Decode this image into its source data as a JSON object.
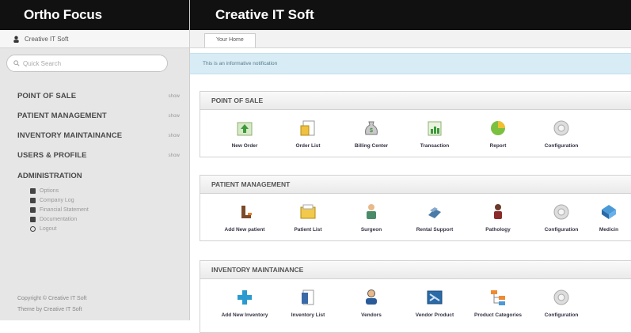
{
  "sidebar": {
    "brand": "Ortho Focus",
    "user": "Creative IT Soft",
    "search_placeholder": "Quick Search",
    "nav": [
      {
        "label": "POINT OF SALE",
        "show": "show"
      },
      {
        "label": "PATIENT MANAGEMENT",
        "show": "show"
      },
      {
        "label": "INVENTORY MAINTAINANCE",
        "show": "show"
      },
      {
        "label": "USERS & PROFILE",
        "show": "show"
      }
    ],
    "admin": {
      "label": "ADMINISTRATION",
      "items": [
        "Options",
        "Company Log",
        "Financial Statement",
        "Documentation",
        "Logout"
      ]
    },
    "footer": [
      "Copyright © Creative IT Soft",
      "Theme by Creative IT Soft"
    ]
  },
  "main": {
    "title": "Creative IT Soft",
    "tab": "Your Home",
    "notification": "This is an informative notification",
    "panels": [
      {
        "title": "POINT OF SALE",
        "items": [
          {
            "label": "New Order",
            "icon": "new-order-icon"
          },
          {
            "label": "Order List",
            "icon": "order-list-icon"
          },
          {
            "label": "Billing Center",
            "icon": "billing-center-icon"
          },
          {
            "label": "Transaction",
            "icon": "transaction-icon"
          },
          {
            "label": "Report",
            "icon": "report-icon"
          },
          {
            "label": "Configuration",
            "icon": "configuration-icon"
          }
        ]
      },
      {
        "title": "PATIENT MANAGEMENT",
        "items": [
          {
            "label": "Add New patient",
            "icon": "add-patient-icon"
          },
          {
            "label": "Patient List",
            "icon": "patient-list-icon"
          },
          {
            "label": "Surgeon",
            "icon": "surgeon-icon"
          },
          {
            "label": "Rental Support",
            "icon": "rental-support-icon"
          },
          {
            "label": "Pathology",
            "icon": "pathology-icon"
          },
          {
            "label": "Configuration",
            "icon": "configuration-icon"
          },
          {
            "label": "Medicin",
            "icon": "medicine-icon"
          }
        ]
      },
      {
        "title": "INVENTORY MAINTAINANCE",
        "items": [
          {
            "label": "Add New Inventory",
            "icon": "add-inventory-icon"
          },
          {
            "label": "Inventory List",
            "icon": "inventory-list-icon"
          },
          {
            "label": "Vendors",
            "icon": "vendors-icon"
          },
          {
            "label": "Vendor Product",
            "icon": "vendor-product-icon"
          },
          {
            "label": "Product Categories",
            "icon": "product-categories-icon"
          },
          {
            "label": "Configuration",
            "icon": "configuration-icon"
          }
        ]
      }
    ]
  }
}
